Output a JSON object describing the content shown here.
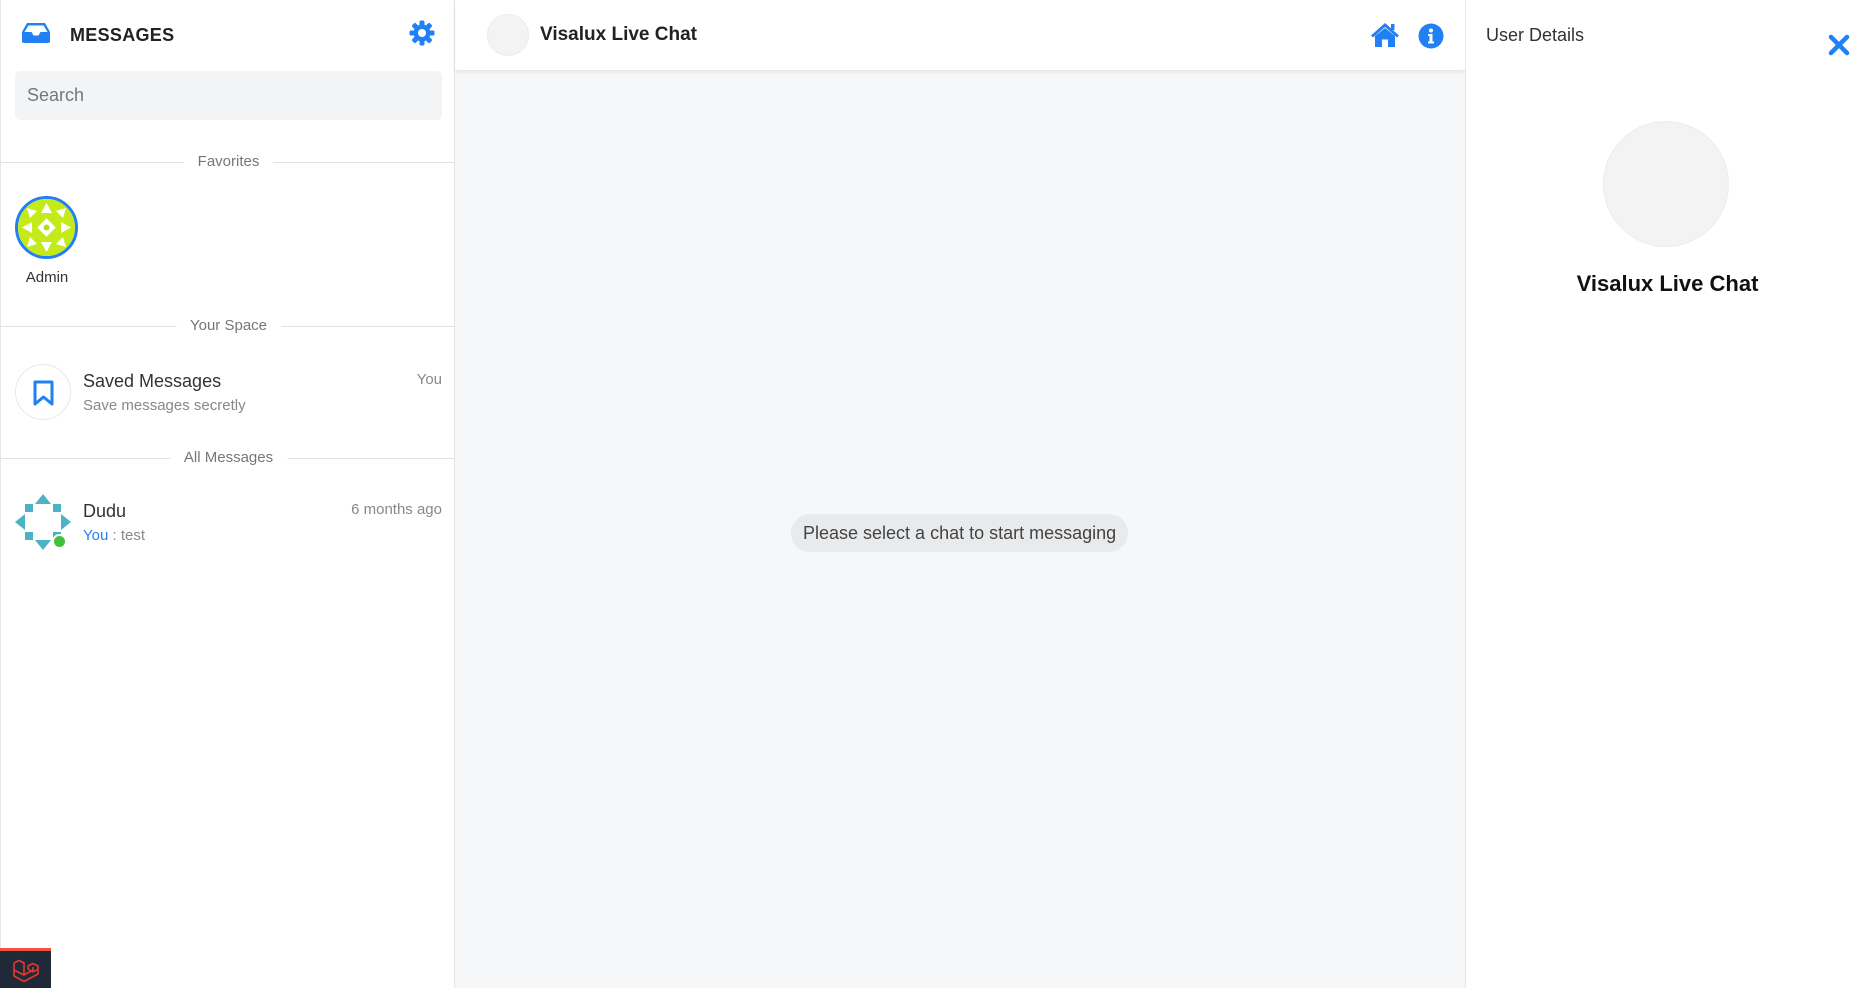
{
  "sidebar": {
    "title": "MESSAGES",
    "search_placeholder": "Search",
    "sections": {
      "favorites": "Favorites",
      "your_space": "Your Space",
      "all_messages": "All Messages"
    },
    "favorites": [
      {
        "name": "Admin"
      }
    ],
    "saved": {
      "name": "Saved Messages",
      "subtitle": "Save messages secretly",
      "tag": "You"
    },
    "contacts": [
      {
        "name": "Dudu",
        "time": "6 months ago",
        "sender": "You",
        "separator": " : ",
        "preview": "test",
        "online": true
      }
    ]
  },
  "chat": {
    "title": "Visalux Live Chat",
    "empty_message": "Please select a chat to start messaging"
  },
  "details": {
    "title": "User Details",
    "name": "Visalux Live Chat"
  },
  "colors": {
    "accent": "#2180f3",
    "online": "#41c03b",
    "background": "#f6f7f9"
  },
  "icons": [
    "inbox-icon",
    "gear-icon",
    "bookmark-icon",
    "home-icon",
    "info-icon",
    "close-icon",
    "laravel-icon"
  ]
}
